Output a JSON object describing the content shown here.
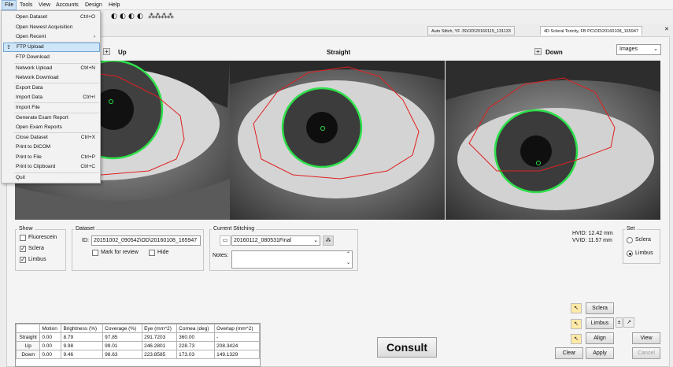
{
  "menubar": [
    "File",
    "Tools",
    "View",
    "Accounts",
    "Design",
    "Help"
  ],
  "toolbar_icons": [
    "eye-icon",
    "eye-icon",
    "eye-icon",
    "eye-icon",
    "pattern-icon",
    "pattern-icon"
  ],
  "tabs": [
    {
      "label": "Auto Stitch, YF JS\\OD\\20160115_131133",
      "selected": false
    },
    {
      "label": "4D Scleral Toricity, FB PC\\OD\\20160108_165947",
      "selected": true
    }
  ],
  "views": {
    "up": "Up",
    "straight": "Straight",
    "down": "Down"
  },
  "images_select": "Images",
  "show": {
    "title": "Show",
    "items": [
      {
        "label": "Fluorescein",
        "checked": false
      },
      {
        "label": "Sclera",
        "checked": true
      },
      {
        "label": "Limbus",
        "checked": true
      }
    ]
  },
  "dataset": {
    "title": "Dataset",
    "id_label": "ID:",
    "id_value": "20151002_090542\\OD\\20160108_165947",
    "mark_for_review": "Mark for review",
    "hide": "Hide"
  },
  "stitching": {
    "title": "Current Stitching",
    "value": "20160112_080531Final",
    "notes_label": "Notes:"
  },
  "measure": {
    "hvid": "HVID: 12.42 mm",
    "vvid": "VVID: 11.57 mm"
  },
  "set": {
    "title": "Set",
    "options": [
      {
        "label": "Sclera",
        "checked": false
      },
      {
        "label": "Limbus",
        "checked": true
      }
    ]
  },
  "buttons": {
    "sclera": "Sclera",
    "limbus": "Limbus",
    "align": "Align",
    "view": "View",
    "clear": "Clear",
    "apply": "Apply",
    "cancel": "Cancel",
    "consult": "Consult"
  },
  "stats": {
    "headers": [
      "",
      "Motion",
      "Brightness (%)",
      "Coverage (%)",
      "Eye (mm^2)",
      "Cornea (deg)",
      "Overlap (mm^2)"
    ],
    "rows": [
      [
        "Straight",
        "0.00",
        "8.79",
        "97.85",
        "291.7203",
        "360.00",
        "-"
      ],
      [
        "Up",
        "0.00",
        "9.98",
        "99.01",
        "246.2801",
        "228.73",
        "208.3424"
      ],
      [
        "Down",
        "0.00",
        "9.46",
        "98.63",
        "223.8585",
        "173.03",
        "149.1329"
      ]
    ]
  },
  "file_menu": [
    {
      "label": "Open Dataset",
      "shortcut": "Ctrl+O"
    },
    {
      "label": "Open Newest Acquisition",
      "shortcut": ""
    },
    {
      "label": "Open Recent",
      "shortcut": "",
      "submenu": true
    },
    {
      "label": "FTP Upload",
      "shortcut": "",
      "highlighted": true,
      "icon": "upload-icon"
    },
    {
      "label": "FTP Download",
      "shortcut": ""
    },
    {
      "label": "Network Upload",
      "shortcut": "Ctrl+N"
    },
    {
      "label": "Network Download",
      "shortcut": ""
    },
    {
      "label": "Export Data",
      "shortcut": ""
    },
    {
      "label": "Import Data",
      "shortcut": "Ctrl+I"
    },
    {
      "label": "Import File",
      "shortcut": ""
    },
    {
      "label": "Generate Exam Report",
      "shortcut": ""
    },
    {
      "label": "Open Exam Reports",
      "shortcut": ""
    },
    {
      "label": "Close Dataset",
      "shortcut": "Ctrl+X"
    },
    {
      "label": "Print to DICOM",
      "shortcut": ""
    },
    {
      "label": "Print to File",
      "shortcut": "Ctrl+P"
    },
    {
      "label": "Print to Clipboard",
      "shortcut": "Ctrl+C"
    },
    {
      "label": "Quit",
      "shortcut": ""
    }
  ],
  "colors": {
    "highlight": "#cfe6f8",
    "sclera_outline": "#e02020",
    "limbus_circle": "#2ee04a"
  }
}
